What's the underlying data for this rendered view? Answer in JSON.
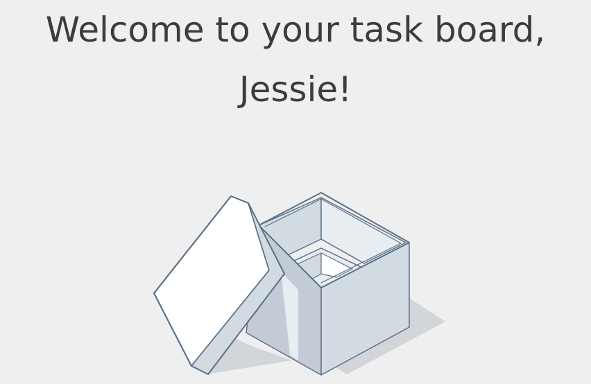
{
  "welcome": {
    "heading": "Welcome to your task board, Jessie!"
  },
  "illustration": {
    "icon": "open-box-icon",
    "colors": {
      "outline": "#5a7186",
      "face_light": "#e8edf2",
      "face_mid": "#d3dbe2",
      "face_dark": "#c3ccd6",
      "lid_top": "#ffffff",
      "shadow": "#cfd4d9"
    }
  }
}
